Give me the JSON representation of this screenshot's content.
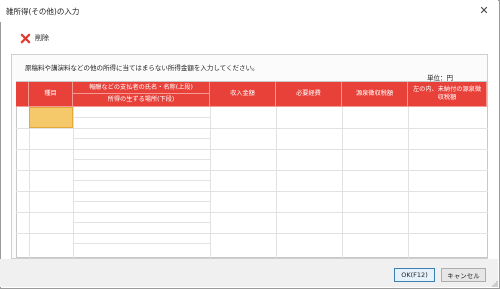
{
  "window": {
    "title": "雑所得(その他)の入力"
  },
  "toolbar": {
    "delete_label": "削除"
  },
  "main": {
    "instruction": "原稿料や講演料などの他の所得に当てはまらない所得金額を入力してください。",
    "unit_label": "単位：円"
  },
  "table": {
    "headers": {
      "category": "種目",
      "payer_name": "報酬などの支払者の氏名・名称(上段)",
      "income_place": "所得の生ずる場所(下段)",
      "revenue": "収入金額",
      "expenses": "必要経費",
      "withholding": "源泉徴収税額",
      "unpaid_withholding": "左の内、未納付の源泉徴収税額"
    }
  },
  "buttons": {
    "ok": "OK(F12)",
    "cancel": "キャンセル"
  },
  "colors": {
    "header_bg": "#e8413a",
    "selected_cell": "#f5c869"
  }
}
